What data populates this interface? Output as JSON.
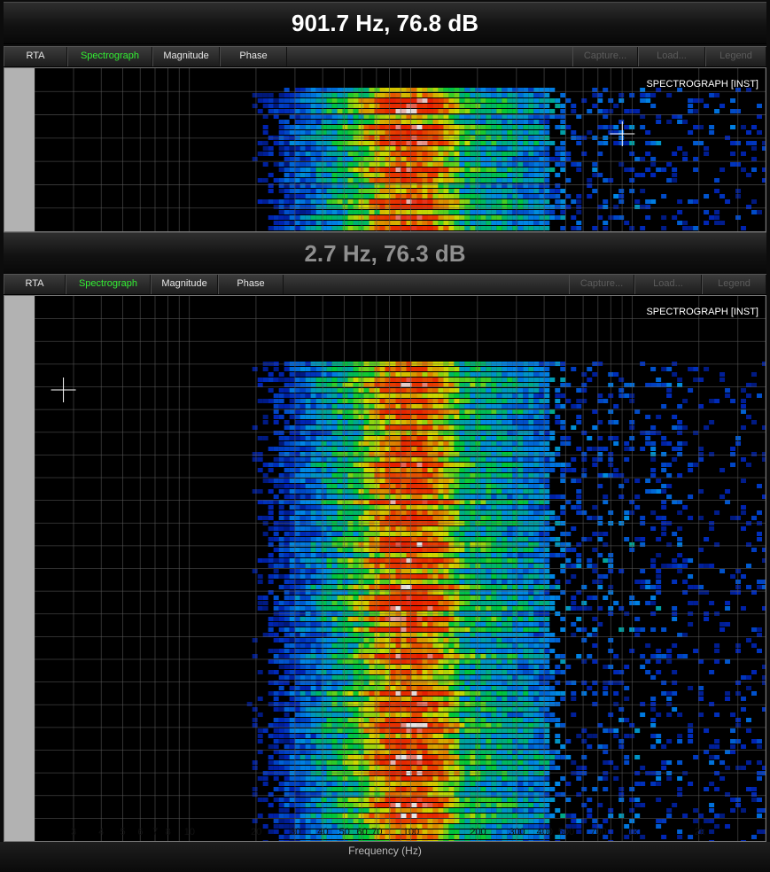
{
  "top_panel": {
    "readout": "901.7 Hz, 76.8 dB",
    "plot_label": "SPECTROGRAPH [INST]"
  },
  "bottom_panel": {
    "readout": "2.7 Hz, 76.3 dB",
    "plot_label": "SPECTROGRAPH [INST]"
  },
  "tabs": [
    {
      "label": "RTA",
      "state": "normal"
    },
    {
      "label": "Spectrograph",
      "state": "active"
    },
    {
      "label": "Magnitude",
      "state": "normal"
    },
    {
      "label": "Phase",
      "state": "normal"
    }
  ],
  "actions": [
    {
      "label": "Capture...",
      "state": "disabled"
    },
    {
      "label": "Load...",
      "state": "disabled"
    },
    {
      "label": "Legend",
      "state": "disabled"
    }
  ],
  "x_axis": {
    "label": "Frequency (Hz)",
    "ticks": [
      {
        "value": 3,
        "text": "3"
      },
      {
        "value": 4,
        "text": "4"
      },
      {
        "value": 5,
        "text": "5"
      },
      {
        "value": 6,
        "text": "6"
      },
      {
        "value": 7,
        "text": "7"
      },
      {
        "value": 8,
        "text": "8"
      },
      {
        "value": 10,
        "text": "10"
      },
      {
        "value": 20,
        "text": "20"
      },
      {
        "value": 30,
        "text": "30"
      },
      {
        "value": 40,
        "text": "40"
      },
      {
        "value": 50,
        "text": "50"
      },
      {
        "value": 60,
        "text": "60"
      },
      {
        "value": 70,
        "text": "70"
      },
      {
        "value": 100,
        "text": "100"
      },
      {
        "value": 200,
        "text": "200"
      },
      {
        "value": 300,
        "text": "300"
      },
      {
        "value": 400,
        "text": "400"
      },
      {
        "value": 500,
        "text": "500"
      },
      {
        "value": 700,
        "text": "700"
      },
      {
        "value": 1000,
        "text": "1k"
      },
      {
        "value": 2000,
        "text": "2k"
      }
    ],
    "scale": "log",
    "range_hz": [
      2,
      4000
    ]
  },
  "colors": {
    "active_tab": "#33ee33",
    "cursor": "#ffffff",
    "background": "#000000",
    "grid": "#5a5a5a"
  },
  "cursors": {
    "top_hz": 901.7,
    "bottom_hz": 2.7
  }
}
